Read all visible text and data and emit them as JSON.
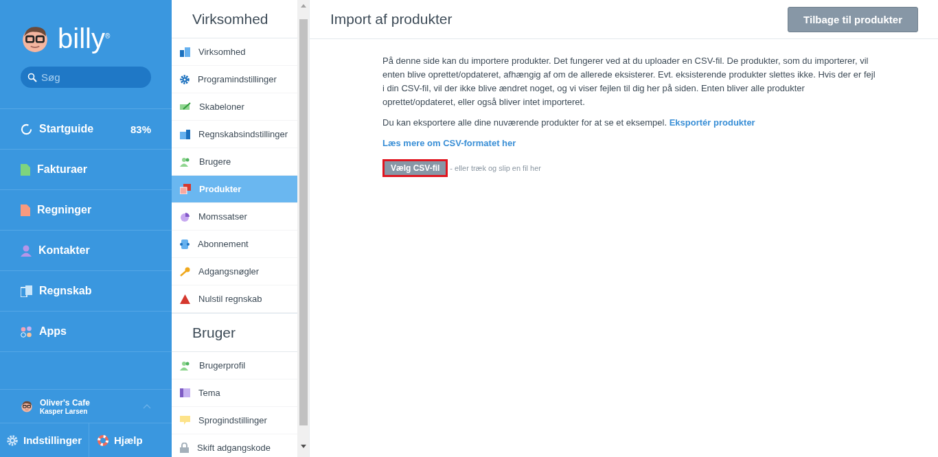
{
  "sidebar": {
    "logo": "billy",
    "logo_mark": "®",
    "search": {
      "placeholder": "Søg"
    },
    "items": [
      {
        "label": "Startguide",
        "badge": "83%"
      },
      {
        "label": "Fakturaer"
      },
      {
        "label": "Regninger"
      },
      {
        "label": "Kontakter"
      },
      {
        "label": "Regnskab"
      },
      {
        "label": "Apps"
      }
    ],
    "organization": {
      "name": "Oliver's Cafe",
      "user": "Kasper Larsen"
    },
    "footer": [
      {
        "label": "Indstillinger"
      },
      {
        "label": "Hjælp"
      }
    ]
  },
  "settings_menu": {
    "sections": [
      {
        "title": "Virksomhed",
        "items": [
          {
            "label": "Virksomhed",
            "selected": false
          },
          {
            "label": "Programindstillinger",
            "selected": false
          },
          {
            "label": "Skabeloner",
            "selected": false
          },
          {
            "label": "Regnskabsindstillinger",
            "selected": false
          },
          {
            "label": "Brugere",
            "selected": false
          },
          {
            "label": "Produkter",
            "selected": true
          },
          {
            "label": "Momssatser",
            "selected": false
          },
          {
            "label": "Abonnement",
            "selected": false
          },
          {
            "label": "Adgangsnøgler",
            "selected": false
          },
          {
            "label": "Nulstil regnskab",
            "selected": false
          }
        ]
      },
      {
        "title": "Bruger",
        "items": [
          {
            "label": "Brugerprofil",
            "selected": false
          },
          {
            "label": "Tema",
            "selected": false
          },
          {
            "label": "Sprogindstillinger",
            "selected": false
          },
          {
            "label": "Skift adgangskode",
            "selected": false
          }
        ]
      }
    ]
  },
  "main": {
    "title": "Import af produkter",
    "back_button": "Tilbage til produkter",
    "description": "På denne side kan du importere produkter. Det fungerer ved at du uploader en CSV-fil. De produkter, som du importerer, vil enten blive oprettet/opdateret, afhængig af om de allerede eksisterer. Evt. eksisterende produkter slettes ikke. Hvis der er fejl i din CSV-fil, vil der ikke blive ændret noget, og vi viser fejlen til dig her på siden. Enten bliver alle produkter oprettet/opdateret, eller også bliver intet importeret.",
    "export_text": "Du kan eksportere alle dine nuværende produkter for at se et eksempel.",
    "export_link": "Eksportér produkter",
    "format_link": "Læs mere om CSV-formatet her",
    "upload_button": {
      "label": "Vælg CSV-fil",
      "highlighted": true
    },
    "drop_hint": "- eller træk og slip en fil her"
  }
}
